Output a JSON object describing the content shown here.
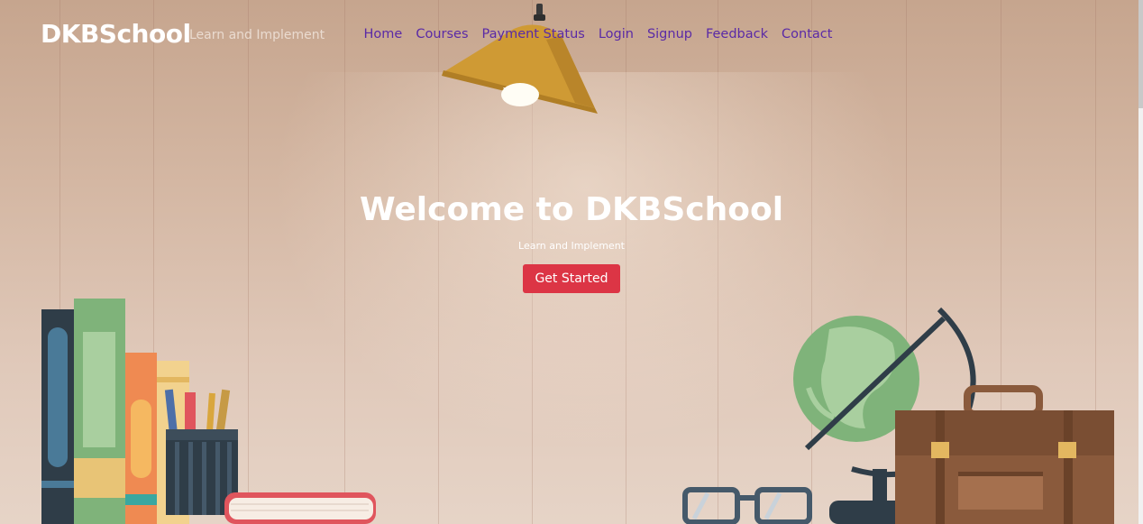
{
  "navbar": {
    "brand": "DKBSchool",
    "tagline": "Learn and Implement",
    "links": [
      "Home",
      "Courses",
      "Payment Status",
      "Login",
      "Signup",
      "Feedback",
      "Contact"
    ]
  },
  "hero": {
    "title": "Welcome to DKBSchool",
    "subtitle": "Learn and Implement",
    "cta_label": "Get Started"
  },
  "colors": {
    "nav_link": "#5a2aa6",
    "cta": "#dc3545",
    "background": "#d4b7a3"
  },
  "illustration": {
    "icons": [
      "lamp-icon",
      "books-icon",
      "pencil-cup-icon",
      "globe-icon",
      "briefcase-icon",
      "glasses-icon"
    ]
  }
}
